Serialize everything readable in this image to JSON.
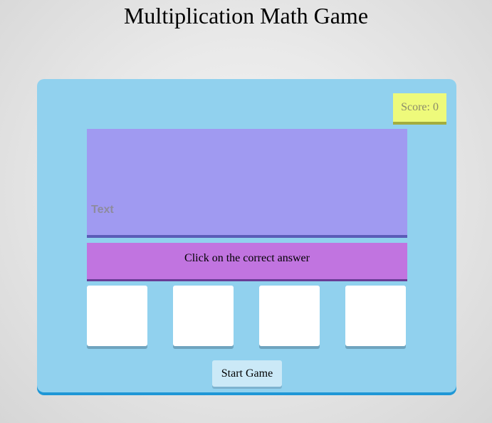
{
  "page": {
    "title": "Multiplication Math Game"
  },
  "game": {
    "score_label": "Score: 0",
    "question_text": "Text",
    "instruction": "Click on the correct answer",
    "choices": [
      "",
      "",
      "",
      ""
    ],
    "start_button_label": "Start Game"
  },
  "colors": {
    "container": "#91d1ee",
    "score_box": "#eefa7b",
    "question_box": "#a09af1",
    "instruction_box": "#c174e0",
    "choice_box": "#ffffff",
    "start_button": "#cbe9f7"
  }
}
